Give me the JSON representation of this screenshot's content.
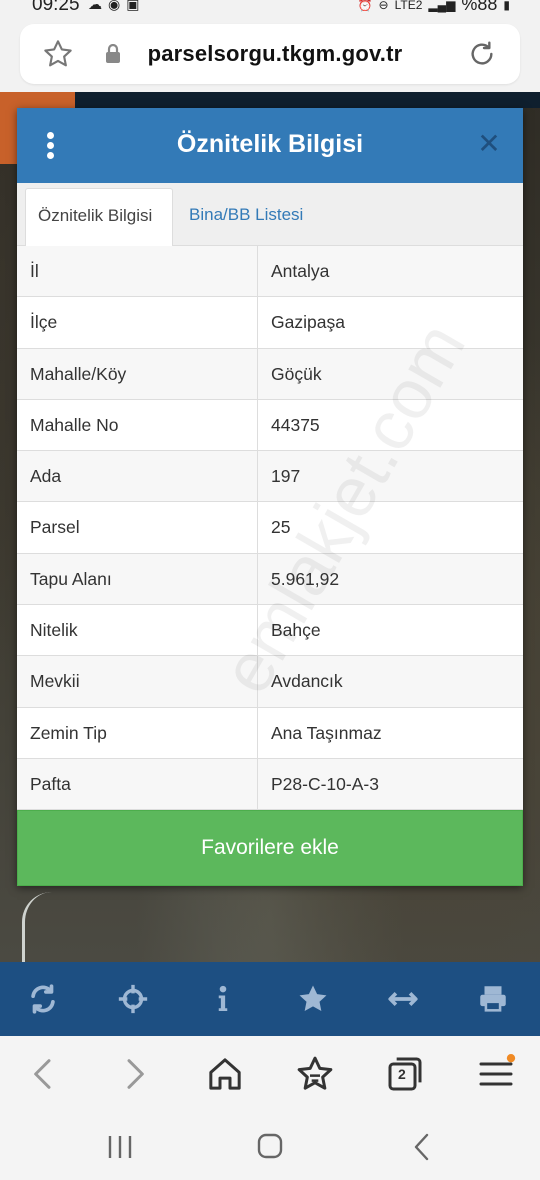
{
  "status_bar": {
    "time": "09:25",
    "network_label": "LTE2",
    "battery": "%88"
  },
  "browser": {
    "url": "parselsorgu.tkgm.gov.tr",
    "tab_count": "2"
  },
  "modal": {
    "title": "Öznitelik Bilgisi",
    "tabs": [
      {
        "label": "Öznitelik Bilgisi",
        "active": true
      },
      {
        "label": "Bina/BB Listesi",
        "active": false
      }
    ],
    "rows": [
      {
        "key": "İl",
        "value": "Antalya"
      },
      {
        "key": "İlçe",
        "value": "Gazipaşa"
      },
      {
        "key": "Mahalle/Köy",
        "value": "Göçük"
      },
      {
        "key": "Mahalle No",
        "value": "44375"
      },
      {
        "key": "Ada",
        "value": "197"
      },
      {
        "key": "Parsel",
        "value": "25"
      },
      {
        "key": "Tapu Alanı",
        "value": "5.961,92"
      },
      {
        "key": "Nitelik",
        "value": "Bahçe"
      },
      {
        "key": "Mevkii",
        "value": "Avdancık"
      },
      {
        "key": "Zemin Tip",
        "value": "Ana Taşınmaz"
      },
      {
        "key": "Pafta",
        "value": "P28-C-10-A-3"
      }
    ],
    "favorite_button": "Favorilere ekle"
  },
  "watermark": "emlakjet.com",
  "toolbar_icons": [
    "refresh-icon",
    "crosshair-icon",
    "info-icon",
    "star-icon",
    "measure-icon",
    "print-icon"
  ],
  "colors": {
    "header_blue": "#337ab7",
    "toolbar_blue": "#1d4f82",
    "favorite_green": "#5cb85c",
    "map_orange": "#c8612a"
  }
}
